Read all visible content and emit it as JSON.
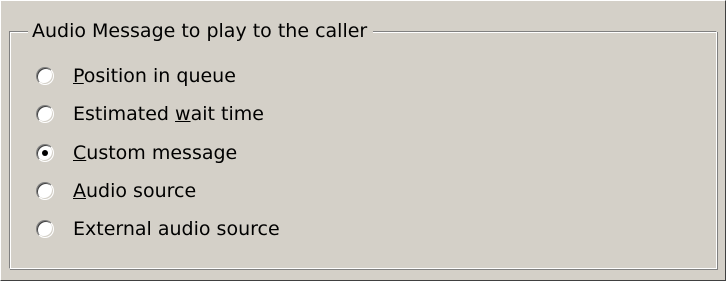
{
  "group": {
    "title": "Audio Message to play to the caller"
  },
  "options": [
    {
      "before": "",
      "mnemonic": "P",
      "after": "osition in queue",
      "checked": false
    },
    {
      "before": "Estimated ",
      "mnemonic": "w",
      "after": "ait time",
      "checked": false
    },
    {
      "before": "",
      "mnemonic": "C",
      "after": "ustom message",
      "checked": true
    },
    {
      "before": "",
      "mnemonic": "A",
      "after": "udio source",
      "checked": false
    },
    {
      "before": "External audio source",
      "mnemonic": "",
      "after": "",
      "checked": false
    }
  ]
}
